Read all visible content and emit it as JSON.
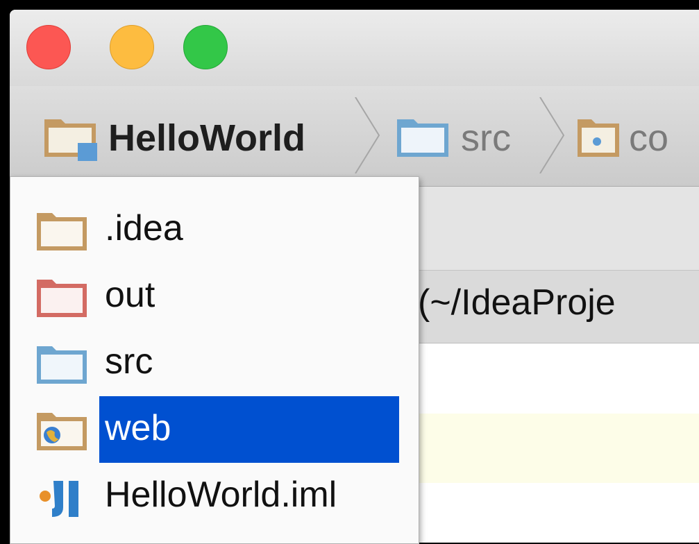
{
  "window": {
    "traffic_lights": [
      "close",
      "minimize",
      "zoom"
    ],
    "colors": {
      "close": "#fc5753",
      "minimize": "#fdbc40",
      "zoom": "#33c748"
    }
  },
  "breadcrumb": [
    {
      "label": "HelloWorld",
      "icon": "project-folder-icon"
    },
    {
      "label": "src",
      "icon": "source-folder-icon"
    },
    {
      "label": "co",
      "icon": "package-folder-icon"
    }
  ],
  "editor": {
    "header_path": "(~/IdeaProje"
  },
  "popup": {
    "items": [
      {
        "label": ".idea",
        "icon": "folder-icon",
        "color": "#c49a62"
      },
      {
        "label": "out",
        "icon": "excluded-folder-icon",
        "color": "#d36b63"
      },
      {
        "label": "src",
        "icon": "source-folder-icon",
        "color": "#6ea6d0"
      },
      {
        "label": "web",
        "icon": "web-folder-icon",
        "color": "#c49a62",
        "selected": true
      },
      {
        "label": "HelloWorld.iml",
        "icon": "module-file-icon",
        "color": "#3a8fd0"
      }
    ],
    "selection_color": "#0050d0"
  }
}
